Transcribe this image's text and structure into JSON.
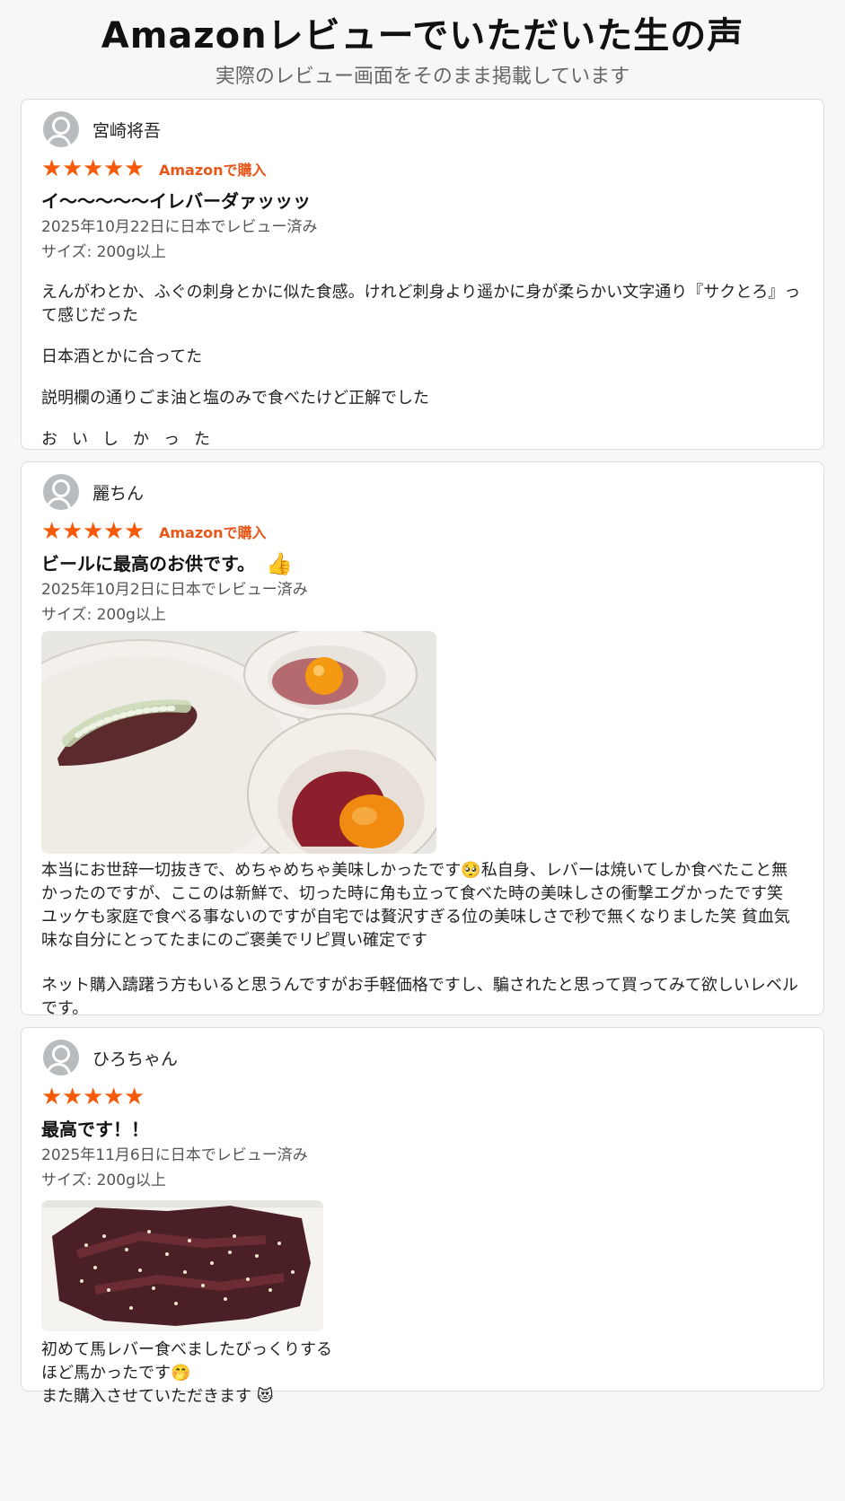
{
  "header": {
    "title": "Amazonレビューでいただいた生の声",
    "subtitle": "実際のレビュー画面をそのまま掲載しています"
  },
  "colors": {
    "star": "#f55a0a",
    "purchase_badge": "#e7571a",
    "avatar": "#b9bcbe"
  },
  "reviews": [
    {
      "name": "宮崎将吾",
      "rating": 5,
      "badge": "Amazonで購入",
      "headline": "イ〜〜〜〜〜イレバーダァッッッ",
      "date": "2025年10月22日に日本でレビュー済み",
      "size": "サイズ: 200g以上",
      "paragraphs": [
        "えんがわとか、ふぐの刺身とかに似た食感。けれど刺身より遥かに身が柔らかい文字通り『サクとろ』って感じだった",
        "日本酒とかに合ってた",
        "説明欄の通りごま油と塩のみで食べたけど正解でした",
        "おいしかった"
      ]
    },
    {
      "name": "麗ちん",
      "rating": 5,
      "badge": "Amazonで購入",
      "headline": "ビールに最高のお供です。",
      "headline_emoji": "👍",
      "date": "2025年10月2日に日本でレビュー済み",
      "size": "サイズ: 200g以上",
      "paragraphs": [
        "本当にお世辞一切抜きで、めちゃめちゃ美味しかったです🥺私自身、レバーは焼いてしか食べたこと無かったのですが、ここのは新鮮で、切った時に角も立って食べた時の美味しさの衝撃エグかったです笑 ユッケも家庭で食べる事ないのですが自宅では贅沢すぎる位の美味しさで秒で無くなりました笑 貧血気味な自分にとってたまにのご褒美でリピ買い確定です",
        "ネット購入躊躇う方もいると思うんですがお手軽価格ですし、騙されたと思って買ってみて欲しいレベルです。"
      ]
    },
    {
      "name": "ひろちゃん",
      "rating": 5,
      "headline": "最高です！！",
      "date": "2025年11月6日に日本でレビュー済み",
      "size": "サイズ: 200g以上",
      "lines": [
        "初めて馬レバー食べましたびっくりする",
        "ほど馬かったです🤭",
        "また購入させていただきます 😻"
      ]
    }
  ]
}
